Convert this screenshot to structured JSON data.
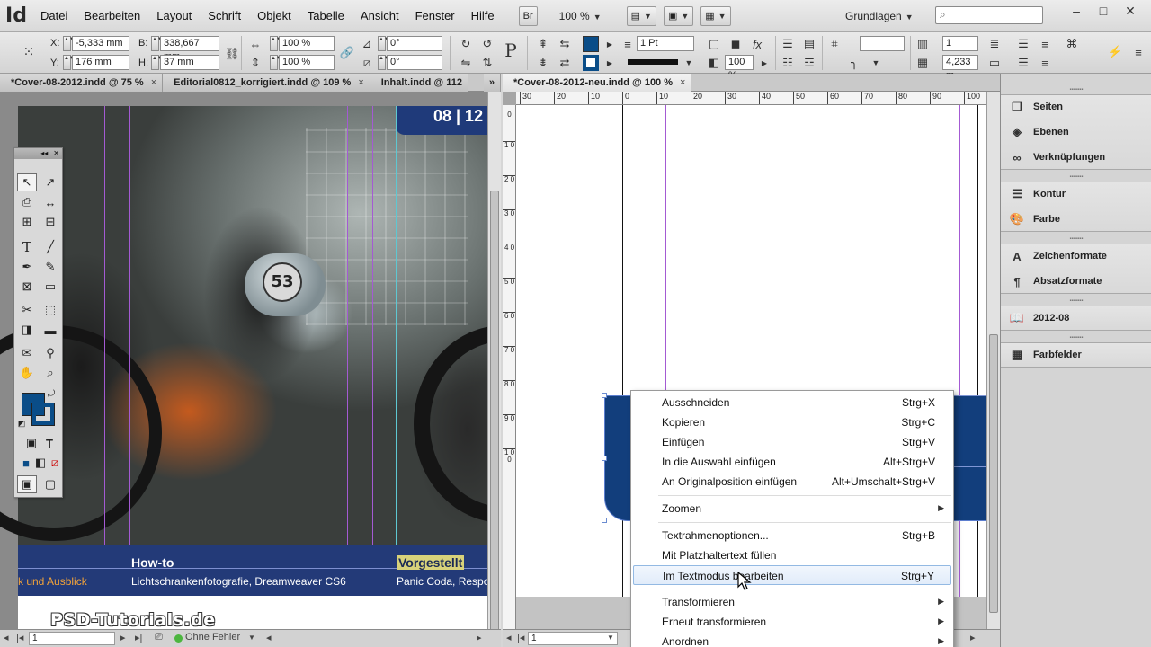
{
  "app": {
    "logo": "Id",
    "menu": [
      "Datei",
      "Bearbeiten",
      "Layout",
      "Schrift",
      "Objekt",
      "Tabelle",
      "Ansicht",
      "Fenster",
      "Hilfe"
    ],
    "bridge": "Br",
    "zoom": "100 %",
    "workspace": "Grundlagen"
  },
  "control": {
    "x_label": "X:",
    "x_value": "-5,333 mm",
    "y_label": "Y:",
    "y_value": "176 mm",
    "w_label": "B:",
    "w_value": "338,667 mm",
    "h_label": "H:",
    "h_value": "37 mm",
    "scale_x": "100 %",
    "scale_y": "100 %",
    "rotate": "0°",
    "shear": "0°",
    "stroke_weight": "1 Pt",
    "opacity": "100 %",
    "columns": "1",
    "gutter": "4,233 m",
    "fill_color": "#0a4d88"
  },
  "tabs_left": [
    {
      "label": "*Cover-08-2012.indd @ 75 %"
    },
    {
      "label": "Editorial0812_korrigiert.indd @ 109 %"
    },
    {
      "label": "Inhalt.indd @ 112"
    }
  ],
  "tab_overflow": "»",
  "tab_right": {
    "label": "*Cover-08-2012-neu.indd @ 100 %"
  },
  "left_doc": {
    "issue": "08 | 12",
    "howto_title": "How-to",
    "howto_sub": "Lichtschrankenfotografie, Dreamweaver CS6",
    "left_text": "k und Ausblick",
    "vorgestellt": "Vorgestellt",
    "panic": "Panic Coda, Respon",
    "logo": "PSD-Tutorials.de",
    "tank_number": "53"
  },
  "ruler_h": [
    "30",
    "20",
    "10",
    "0",
    "10",
    "20",
    "30",
    "40",
    "50",
    "60",
    "70",
    "80",
    "90",
    "100"
  ],
  "ruler_v": [
    "0",
    "1 0",
    "2 0",
    "3 0",
    "4 0",
    "5 0",
    "6 0",
    "7 0",
    "8 0",
    "9 0",
    "1 0 0"
  ],
  "status_left": {
    "page": "1",
    "preflight": "Ohne Fehler"
  },
  "status_right": {
    "page": "1"
  },
  "panels": [
    {
      "label": "Seiten",
      "icon": "pages-icon"
    },
    {
      "label": "Ebenen",
      "icon": "layers-icon"
    },
    {
      "label": "Verknüpfungen",
      "icon": "links-icon"
    },
    {
      "label": "Kontur",
      "icon": "stroke-icon"
    },
    {
      "label": "Farbe",
      "icon": "color-icon"
    },
    {
      "label": "Zeichenformate",
      "icon": "character-styles-icon"
    },
    {
      "label": "Absatzformate",
      "icon": "paragraph-styles-icon"
    },
    {
      "label": "2012-08",
      "icon": "library-icon"
    },
    {
      "label": "Farbfelder",
      "icon": "swatches-icon"
    }
  ],
  "context_menu": [
    {
      "label": "Ausschneiden",
      "shortcut": "Strg+X"
    },
    {
      "label": "Kopieren",
      "shortcut": "Strg+C"
    },
    {
      "label": "Einfügen",
      "shortcut": "Strg+V"
    },
    {
      "label": "In die Auswahl einfügen",
      "shortcut": "Alt+Strg+V"
    },
    {
      "label": "An Originalposition einfügen",
      "shortcut": "Alt+Umschalt+Strg+V"
    },
    {
      "label": "Zoomen",
      "shortcut": ""
    },
    {
      "label": "Textrahmenoptionen...",
      "shortcut": "Strg+B"
    },
    {
      "label": "Mit Platzhaltertext füllen",
      "shortcut": ""
    },
    {
      "label": "Im Textmodus bearbeiten",
      "shortcut": "Strg+Y"
    },
    {
      "label": "Transformieren",
      "shortcut": ""
    },
    {
      "label": "Erneut transformieren",
      "shortcut": ""
    },
    {
      "label": "Anordnen",
      "shortcut": ""
    }
  ]
}
